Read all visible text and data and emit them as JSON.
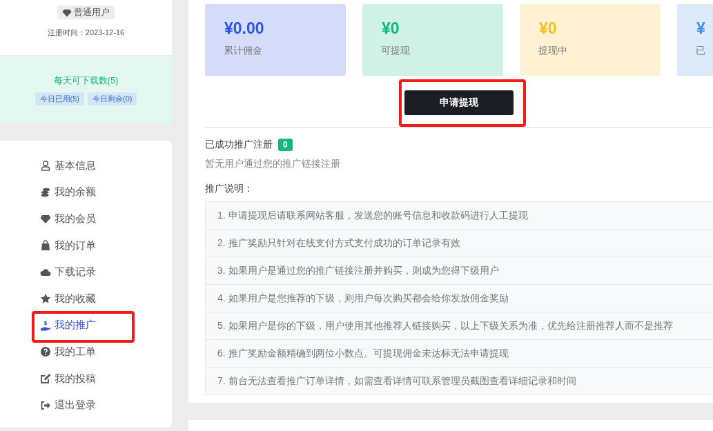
{
  "profile": {
    "level_badge": "普通用户",
    "register_date": "注册时间：2023-12-16"
  },
  "downloads": {
    "title": "每天可下载数(5)",
    "tags": [
      "今日已用(5)",
      "今日剩余(0)"
    ]
  },
  "sidebar": {
    "items": [
      {
        "label": "基本信息",
        "kind": "user",
        "selected": false,
        "highlighted": false
      },
      {
        "label": "我的余额",
        "kind": "coins",
        "selected": false,
        "highlighted": false
      },
      {
        "label": "我的会员",
        "kind": "gem",
        "selected": false,
        "highlighted": false
      },
      {
        "label": "我的订单",
        "kind": "bag",
        "selected": false,
        "highlighted": false
      },
      {
        "label": "下载记录",
        "kind": "cloud",
        "selected": false,
        "highlighted": false
      },
      {
        "label": "我的收藏",
        "kind": "star",
        "selected": false,
        "highlighted": false
      },
      {
        "label": "我的推广",
        "kind": "hand",
        "selected": true,
        "highlighted": true
      },
      {
        "label": "我的工单",
        "kind": "question",
        "selected": false,
        "highlighted": false
      },
      {
        "label": "我的投稿",
        "kind": "edit",
        "selected": false,
        "highlighted": false
      },
      {
        "label": "退出登录",
        "kind": "logout",
        "selected": false,
        "highlighted": false
      }
    ]
  },
  "stats": [
    {
      "amount": "¥0.00",
      "label": "累计佣金",
      "color": "#2b55e6"
    },
    {
      "amount": "¥0",
      "label": "可提现",
      "color": "#10b981"
    },
    {
      "amount": "¥0",
      "label": "提现中",
      "color": "#fbbf24"
    },
    {
      "amount": "¥",
      "label": "已",
      "color": "#4a90e2"
    }
  ],
  "withdraw_button": {
    "label": "申请提现",
    "highlighted": true
  },
  "referrals": {
    "title": "已成功推广注册",
    "count": "0",
    "empty_text": "暂无用户通过您的推广链接注册"
  },
  "notes": {
    "title": "推广说明：",
    "items": [
      "1. 申请提现后请联系网站客服，发送您的账号信息和收款码进行人工提现",
      "2. 推广奖励只针对在线支付方式支付成功的订单记录有效",
      "3. 如果用户是通过您的推广链接注册并购买，则成为您得下级用户",
      "4. 如果用户是您推荐的下级，则用户每次购买都会给你发放佣金奖励",
      "5. 如果用户是你的下级，用户使用其他推荐人链接购买，以上下级关系为准，优先给注册推荐人而不是推荐",
      "6. 推广奖励金额精确到两位小数点。可提现佣金未达标无法申请提现",
      "7. 前台无法查看推广订单详情，如需查看详情可联系管理员截图查看详细记录和时间"
    ]
  }
}
